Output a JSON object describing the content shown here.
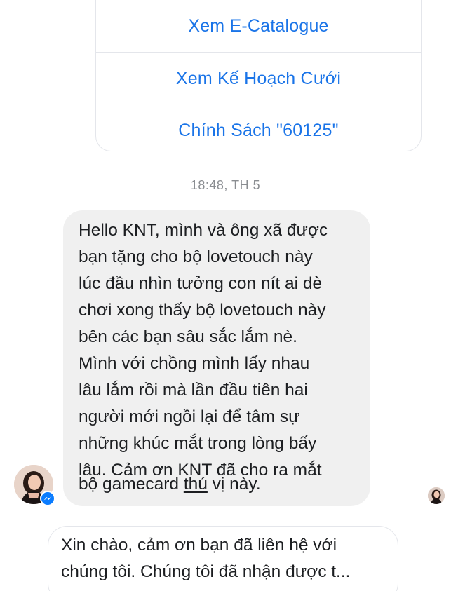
{
  "quick_replies": [
    {
      "label": "Xem E-Catalogue"
    },
    {
      "label": "Xem Kế Hoạch Cưới"
    },
    {
      "label": "Chính Sách \"60125\""
    }
  ],
  "timestamp": "18:48, TH 5",
  "incoming_message": {
    "lines": [
      "Hello KNT, mình và ông xã được",
      "bạn tặng cho bộ lovetouch này",
      "lúc đầu nhìn tưởng con nít ai dè",
      "chơi xong thấy bộ lovetouch này",
      "bên các bạn sâu sắc lắm nè.",
      "Mình với chồng mình lấy nhau",
      "lâu lắm rồi mà lần đầu tiên hai",
      "người mới ngồi lại để tâm sự",
      "những khúc mắt trong lòng bấy",
      "lâu. Cảm ơn KNT đã cho ra mắt"
    ],
    "last_line_prefix": "bộ gamecard ",
    "last_line_link": "thú",
    "last_line_suffix": " vị này."
  },
  "reply_message": {
    "lines": [
      "Xin chào, cảm ơn bạn đã liên hệ với",
      "chúng tôi. Chúng tôi đã nhận được t..."
    ]
  },
  "colors": {
    "link_blue": "#1a74e8",
    "bubble_gray": "#f0f0f0",
    "messenger_blue": "#0a7cff"
  },
  "icons": {
    "avatar": "user-avatar",
    "badge": "messenger-icon",
    "receipt": "read-receipt-avatar"
  }
}
